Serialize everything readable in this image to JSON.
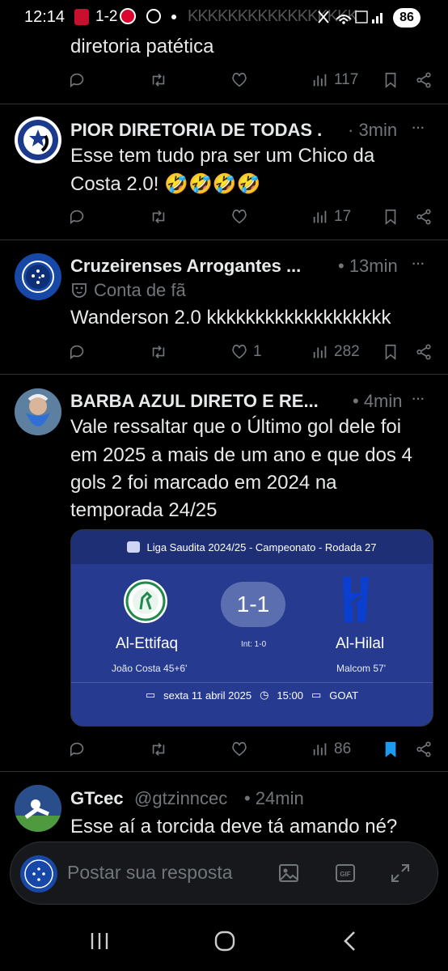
{
  "status_bar": {
    "time": "12:14",
    "score": "1-2",
    "overlay": "KKKKKKKKKKKKKKKKK",
    "battery": "86"
  },
  "top_fragment": {
    "text": "diretoria patética",
    "views": "117"
  },
  "tweets": [
    {
      "name": "PIOR DIRETORIA DE TODAS .",
      "time": "· 3min",
      "text_lines": [
        "Esse tem tudo pra ser um Chico da",
        "Costa 2.0! 🤣🤣🤣🤣"
      ],
      "likes": "",
      "views": "17"
    },
    {
      "name": "Cruzeirenses Arrogantes ...",
      "time": "• 13min",
      "label": "Conta de fã",
      "text_lines": [
        "Wanderson 2.0 kkkkkkkkkkkkkkkkkkk"
      ],
      "likes": "1",
      "views": "282"
    },
    {
      "name": "BARBA AZUL DIRETO E RE...",
      "time": "• 4min",
      "text_lines": [
        "Vale ressaltar que o Último gol dele foi",
        "em 2025 a mais de um ano e que dos 4",
        "gols 2 foi marcado em 2024 na",
        "temporada 24/25"
      ],
      "views": "86",
      "card": {
        "header": "Liga Saudita 2024/25 - Campeonato  - Rodada 27",
        "score": "1-1",
        "halftime": "Int: 1-0",
        "home_team": "Al-Ettifaq",
        "away_team": "Al-Hilal",
        "home_scorer": "João Costa 45+6'",
        "away_scorer": "Malcom 57'",
        "date": "sexta 11 abril 2025",
        "time": "15:00",
        "broadcast": "GOAT"
      }
    },
    {
      "name": "GTcec",
      "handle": "@gtzinncec",
      "time": "• 24min",
      "text_lines": [
        "Esse aí a torcida deve tá amando né?"
      ]
    }
  ],
  "reply_bar": {
    "placeholder": "Postar sua resposta"
  },
  "colors": {
    "background": "#000000",
    "text": "#e7e9ea",
    "muted": "#71767b",
    "accent": "#1d9bf0",
    "card": "#263a8f"
  }
}
